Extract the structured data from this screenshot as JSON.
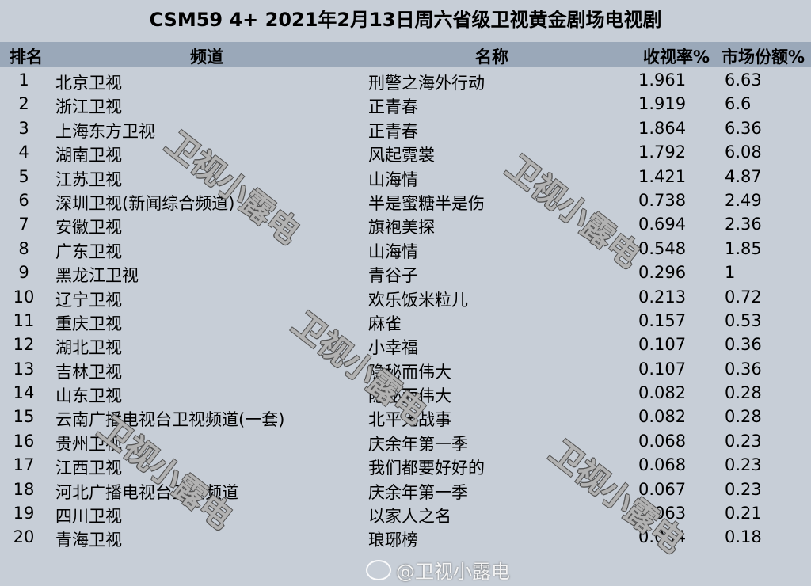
{
  "title": "CSM59 4+ 2021年2月13日周六省级卫视黄金剧场电视剧",
  "header": {
    "rank": "排名",
    "channel": "频道",
    "show": "名称",
    "rating": "收视率%",
    "share": "市场份额%"
  },
  "rows": [
    {
      "rank": "1",
      "channel": "北京卫视",
      "show": "刑警之海外行动",
      "rating": "1.961",
      "share": "6.63"
    },
    {
      "rank": "2",
      "channel": "浙江卫视",
      "show": "正青春",
      "rating": "1.919",
      "share": "6.6"
    },
    {
      "rank": "3",
      "channel": "上海东方卫视",
      "show": "正青春",
      "rating": "1.864",
      "share": "6.36"
    },
    {
      "rank": "4",
      "channel": "湖南卫视",
      "show": "风起霓裳",
      "rating": "1.792",
      "share": "6.08"
    },
    {
      "rank": "5",
      "channel": "江苏卫视",
      "show": "山海情",
      "rating": "1.421",
      "share": "4.87"
    },
    {
      "rank": "6",
      "channel": "深圳卫视(新闻综合频道)",
      "show": "半是蜜糖半是伤",
      "rating": "0.738",
      "share": "2.49"
    },
    {
      "rank": "7",
      "channel": "安徽卫视",
      "show": "旗袍美探",
      "rating": "0.694",
      "share": "2.36"
    },
    {
      "rank": "8",
      "channel": "广东卫视",
      "show": "山海情",
      "rating": "0.548",
      "share": "1.85"
    },
    {
      "rank": "9",
      "channel": "黑龙江卫视",
      "show": "青谷子",
      "rating": "0.296",
      "share": "1"
    },
    {
      "rank": "10",
      "channel": "辽宁卫视",
      "show": "欢乐饭米粒儿",
      "rating": "0.213",
      "share": "0.72"
    },
    {
      "rank": "11",
      "channel": "重庆卫视",
      "show": "麻雀",
      "rating": "0.157",
      "share": "0.53"
    },
    {
      "rank": "12",
      "channel": "湖北卫视",
      "show": "小幸福",
      "rating": "0.107",
      "share": "0.36"
    },
    {
      "rank": "13",
      "channel": "吉林卫视",
      "show": "隐秘而伟大",
      "rating": "0.107",
      "share": "0.36"
    },
    {
      "rank": "14",
      "channel": "山东卫视",
      "show": "隐秘而伟大",
      "rating": "0.082",
      "share": "0.28"
    },
    {
      "rank": "15",
      "channel": "云南广播电视台卫视频道(一套)",
      "show": "北平无战事",
      "rating": "0.082",
      "share": "0.28"
    },
    {
      "rank": "16",
      "channel": "贵州卫视",
      "show": "庆余年第一季",
      "rating": "0.068",
      "share": "0.23"
    },
    {
      "rank": "17",
      "channel": "江西卫视",
      "show": "我们都要好好的",
      "rating": "0.068",
      "share": "0.23"
    },
    {
      "rank": "18",
      "channel": "河北广播电视台卫视频道",
      "show": "庆余年第一季",
      "rating": "0.067",
      "share": "0.23"
    },
    {
      "rank": "19",
      "channel": "四川卫视",
      "show": "以家人之名",
      "rating": "0.063",
      "share": "0.21"
    },
    {
      "rank": "20",
      "channel": "青海卫视",
      "show": "琅琊榜",
      "rating": "0.054",
      "share": "0.18"
    }
  ],
  "watermark": "卫视小露电",
  "footer_watermark": "@卫视小露电"
}
